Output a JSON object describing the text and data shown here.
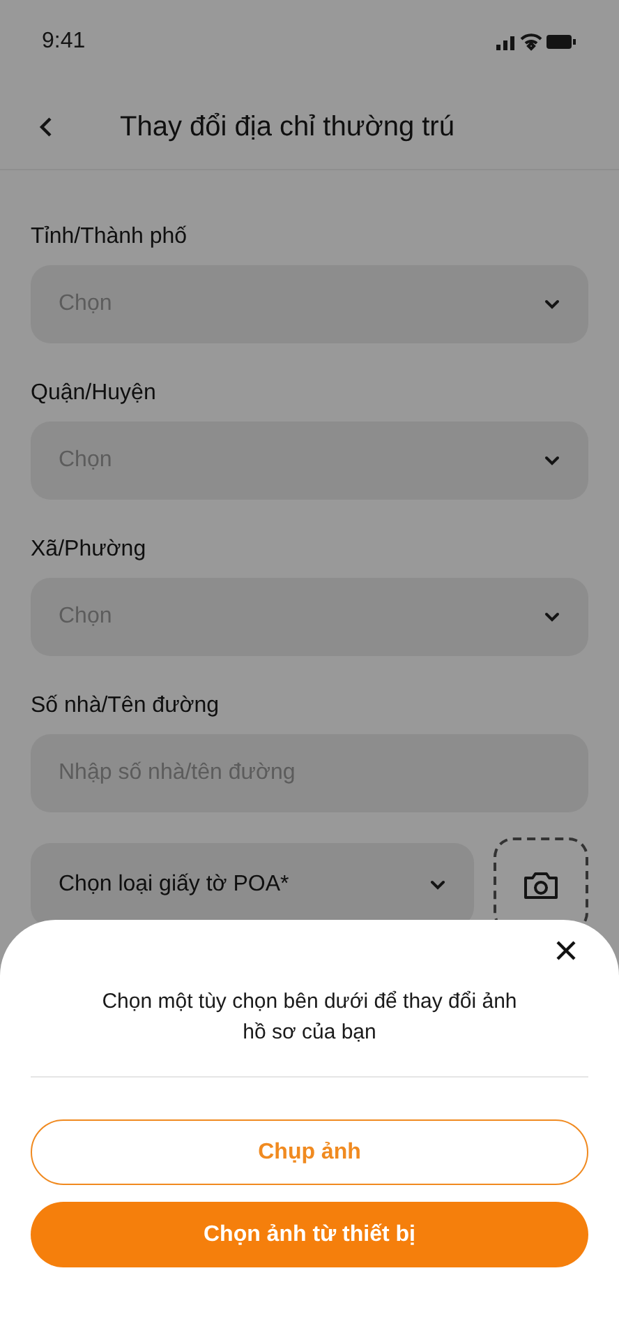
{
  "status_bar": {
    "time": "9:41"
  },
  "header": {
    "title": "Thay đổi địa chỉ thường trú"
  },
  "fields": [
    {
      "kind": "select",
      "label": "Tỉnh/Thành phố",
      "placeholder": "Chọn"
    },
    {
      "kind": "select",
      "label": "Quận/Huyện",
      "placeholder": "Chọn"
    },
    {
      "kind": "select",
      "label": "Xã/Phường",
      "placeholder": "Chọn"
    },
    {
      "kind": "input",
      "label": "Số nhà/Tên đường",
      "placeholder": "Nhập số nhà/tên đường"
    }
  ],
  "document": {
    "placeholder": "Chọn loại giấy tờ POA*"
  },
  "sheet": {
    "message": "Chọn một tùy chọn bên dưới để thay đổi ảnh hồ sơ của bạn",
    "buttons": [
      {
        "kind": "outline",
        "label": "Chụp ảnh"
      },
      {
        "kind": "filled",
        "label": "Chọn ảnh từ thiết bị"
      }
    ]
  }
}
